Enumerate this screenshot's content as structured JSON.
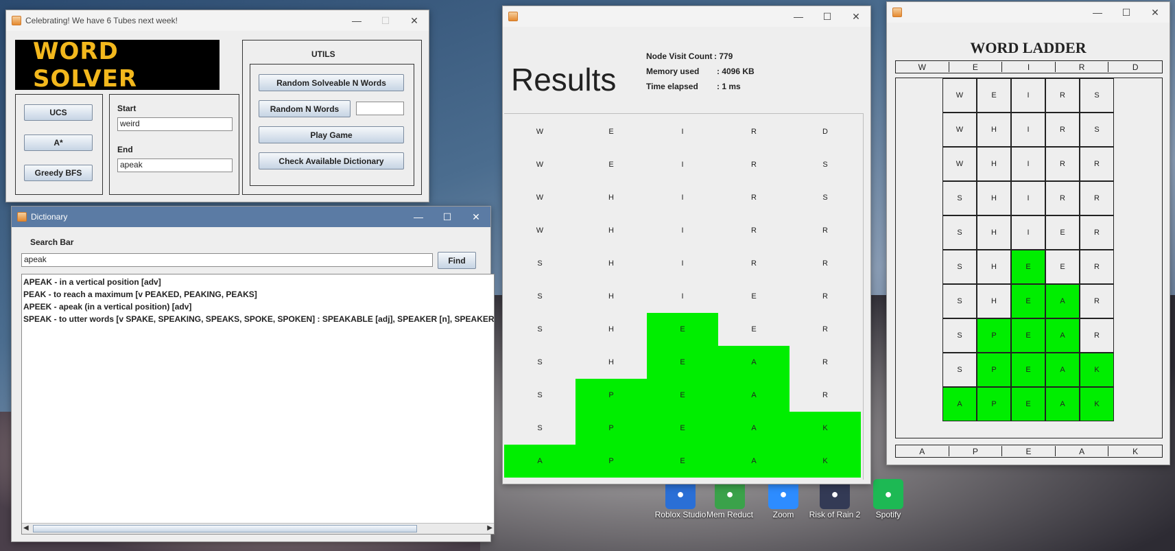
{
  "solver": {
    "title": "Celebrating! We have 6 Tubes next week!",
    "logo": "WORD SOLVER",
    "algorithms": [
      "UCS",
      "A*",
      "Greedy BFS"
    ],
    "start_label": "Start",
    "start_value": "weird",
    "end_label": "End",
    "end_value": "apeak",
    "utils_title": "UTILS",
    "btn_random_solveable": "Random Solveable N Words",
    "btn_random_n": "Random N Words",
    "random_n_value": "",
    "btn_play": "Play Game",
    "btn_check_dict": "Check Available Dictionary"
  },
  "dictionary": {
    "title": "Dictionary",
    "search_label": "Search Bar",
    "search_value": "apeak",
    "find_label": "Find",
    "results": [
      "APEAK - in a vertical position [adv]",
      "PEAK - to reach a maximum [v PEAKED, PEAKING, PEAKS]",
      "APEEK - apeak (in a vertical position) [adv]",
      "SPEAK - to utter words [v SPAKE, SPEAKING, SPEAKS, SPOKE, SPOKEN] : SPEAKABLE [adj], SPEAKER [n], SPEAKERSHI"
    ]
  },
  "results": {
    "heading": "Results",
    "node_visit_label": "Node Visit Count",
    "node_visit_value": ": 779",
    "memory_label": "Memory used",
    "memory_value": ": 4096 KB",
    "time_label": "Time elapsed",
    "time_value": ": 1 ms",
    "rows": [
      "WEIRD",
      "WEIRS",
      "WHIRS",
      "WHIRR",
      "SHIRR",
      "SHIER",
      "SHEER",
      "SHEAR",
      "SPEAR",
      "SPEAK",
      "APEAK"
    ],
    "matched": [
      [
        0,
        0,
        0,
        0,
        0
      ],
      [
        0,
        0,
        0,
        0,
        0
      ],
      [
        0,
        0,
        0,
        0,
        0
      ],
      [
        0,
        0,
        0,
        0,
        0
      ],
      [
        0,
        0,
        0,
        0,
        0
      ],
      [
        0,
        0,
        0,
        0,
        0
      ],
      [
        0,
        0,
        1,
        0,
        0
      ],
      [
        0,
        0,
        1,
        1,
        0
      ],
      [
        0,
        1,
        1,
        1,
        0
      ],
      [
        0,
        1,
        1,
        1,
        1
      ],
      [
        1,
        1,
        1,
        1,
        1
      ]
    ],
    "match_color": "#00ee00"
  },
  "ladder": {
    "title": "WORD LADDER",
    "start_word": [
      "W",
      "E",
      "I",
      "R",
      "D"
    ],
    "end_word": [
      "A",
      "P",
      "E",
      "A",
      "K"
    ],
    "rows": [
      "WEIRS",
      "WHIRS",
      "WHIRR",
      "SHIRR",
      "SHIER",
      "SHEER",
      "SHEAR",
      "SPEAR",
      "SPEAK",
      "APEAK"
    ],
    "matched": [
      [
        0,
        0,
        0,
        0,
        0
      ],
      [
        0,
        0,
        0,
        0,
        0
      ],
      [
        0,
        0,
        0,
        0,
        0
      ],
      [
        0,
        0,
        0,
        0,
        0
      ],
      [
        0,
        0,
        0,
        0,
        0
      ],
      [
        0,
        0,
        1,
        0,
        0
      ],
      [
        0,
        0,
        1,
        1,
        0
      ],
      [
        0,
        1,
        1,
        1,
        0
      ],
      [
        0,
        1,
        1,
        1,
        1
      ],
      [
        1,
        1,
        1,
        1,
        1
      ]
    ]
  },
  "desktop_icons": [
    {
      "label": "Roblox Studio",
      "icon": "roblox-icon",
      "color": "#2a6fd6"
    },
    {
      "label": "Mem Reduct",
      "icon": "mem-reduct-icon",
      "color": "#3aa24a"
    },
    {
      "label": "Zoom",
      "icon": "zoom-icon",
      "color": "#2d8cff"
    },
    {
      "label": "Risk of Rain 2",
      "icon": "risk-of-rain-icon",
      "color": "#333a55"
    },
    {
      "label": "Spotify",
      "icon": "spotify-icon",
      "color": "#1db954"
    }
  ]
}
